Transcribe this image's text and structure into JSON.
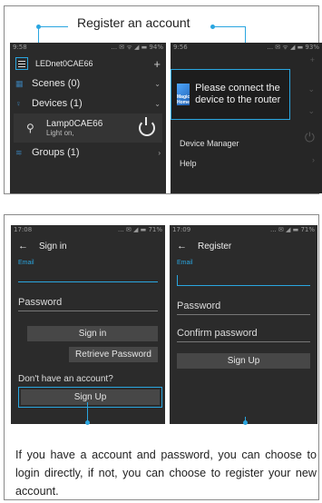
{
  "header": {
    "title": "Register an account"
  },
  "screen_home": {
    "status_time": "9:58",
    "status_icons": "... ✉ ᯤ ◢ ▬ 94%",
    "device_name": "LEDnet0CAE66",
    "add_label": "+",
    "rows": [
      {
        "label": "Scenes (0)",
        "icon": "scenes-icon"
      },
      {
        "label": "Devices (1)",
        "icon": "bulb-icon"
      },
      {
        "label": "Groups (1)",
        "icon": "wifi-icon"
      }
    ],
    "device": {
      "name": "Lamp0CAE66",
      "status": "Light on,"
    }
  },
  "screen_menu": {
    "status_time": "9:56",
    "status_icons": "... ✉ ᯤ ◢ ▬ 93%",
    "popup_text": "Please connect the device to the router",
    "logo_text": "Magic Home",
    "menu_items": [
      "Device Manager",
      "Help"
    ]
  },
  "screen_signin": {
    "status_time": "17:08",
    "status_icons": "... ✉ ◢ ▬ 71%",
    "title": "Sign in",
    "email_label": "Email",
    "password_placeholder": "Password",
    "signin_button": "Sign in",
    "retrieve_button": "Retrieve Password",
    "question": "Don't have an account?",
    "signup_button": "Sign Up"
  },
  "screen_register": {
    "status_time": "17:09",
    "status_icons": "... ✉ ◢ ▬ 71%",
    "title": "Register",
    "email_label": "Email",
    "password_placeholder": "Password",
    "confirm_placeholder": "Confirm password",
    "signup_button": "Sign Up"
  },
  "caption": "If you have a account and password, you can choose to login directly, if not, you can choose to register your new account.",
  "colors": {
    "accent": "#2aa6e0",
    "screen_bg": "#2b2b2b"
  }
}
